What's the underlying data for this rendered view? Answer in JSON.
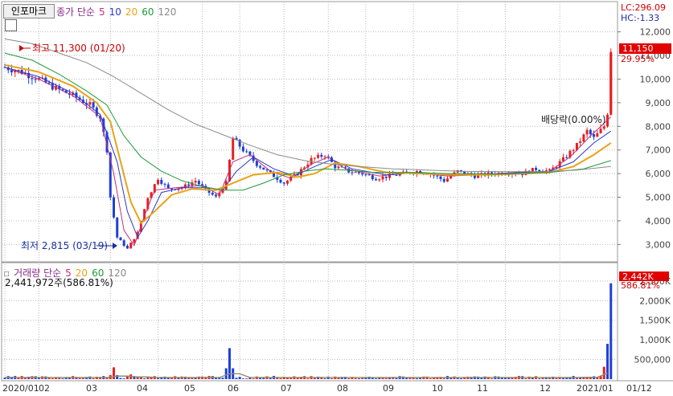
{
  "window": {
    "tab_label": "인포마크",
    "price_legend": {
      "name": "종가 단순",
      "ma": [
        "5",
        "10",
        "20",
        "60",
        "120"
      ]
    },
    "volume_legend": {
      "name": "거래량 단순",
      "ma": [
        "5",
        "20",
        "60",
        "120"
      ]
    }
  },
  "colors": {
    "up": "#e62020",
    "down": "#1f3fd8",
    "ma5": "#c0307a",
    "ma10": "#2c39c8",
    "ma20": "#e8a317",
    "ma60": "#1f9a3a",
    "ma120": "#8a8a8a",
    "label_red": "#cc0000"
  },
  "chart_data": [
    {
      "type": "candlestick",
      "x_ticks": [
        "2020/01",
        "02",
        "03",
        "04",
        "05",
        "06",
        "07",
        "08",
        "09",
        "10",
        "11",
        "12",
        "2021/01",
        "01/12"
      ],
      "y_ticks": [
        "3,000",
        "4,000",
        "5,000",
        "6,000",
        "7,000",
        "8,000",
        "9,000",
        "10,000",
        "11,000",
        "12,000"
      ],
      "ylim": [
        2400,
        12600
      ],
      "annotations": {
        "high": "최고 11,300 (01/20)",
        "low": "최저 2,815 (03/19)",
        "dividend": "배당락(0.00%)",
        "lc": "LC:296.09",
        "hc": "HC:-1.33"
      },
      "last_price": {
        "value": "11,150",
        "change": "29.95%"
      },
      "price_path": [
        [
          0,
          10500
        ],
        [
          5,
          10300
        ],
        [
          10,
          10000
        ],
        [
          15,
          9600
        ],
        [
          20,
          9300
        ],
        [
          25,
          8900
        ],
        [
          28,
          8400
        ],
        [
          30,
          7000
        ],
        [
          31,
          5000
        ],
        [
          33,
          3300
        ],
        [
          36,
          2815
        ],
        [
          39,
          3500
        ],
        [
          42,
          5000
        ],
        [
          45,
          5800
        ],
        [
          48,
          5350
        ],
        [
          52,
          5400
        ],
        [
          56,
          5700
        ],
        [
          59,
          5300
        ],
        [
          62,
          5000
        ],
        [
          65,
          5600
        ],
        [
          67,
          7500
        ],
        [
          70,
          7000
        ],
        [
          74,
          6400
        ],
        [
          78,
          6000
        ],
        [
          82,
          5600
        ],
        [
          86,
          6000
        ],
        [
          90,
          6600
        ],
        [
          94,
          6800
        ],
        [
          97,
          6300
        ],
        [
          101,
          6100
        ],
        [
          105,
          6000
        ],
        [
          109,
          5800
        ],
        [
          113,
          5900
        ],
        [
          117,
          6000
        ],
        [
          121,
          6100
        ],
        [
          125,
          6000
        ],
        [
          129,
          5700
        ],
        [
          133,
          6100
        ],
        [
          138,
          5900
        ],
        [
          143,
          6000
        ],
        [
          148,
          6050
        ],
        [
          152,
          6000
        ],
        [
          156,
          6200
        ],
        [
          160,
          6100
        ],
        [
          164,
          6600
        ],
        [
          168,
          7200
        ],
        [
          171,
          7800
        ],
        [
          173,
          7500
        ],
        [
          176,
          8000
        ],
        [
          177,
          8580
        ],
        [
          178,
          11150
        ]
      ],
      "ma_paths": {
        "ma5": [
          [
            0,
            10500
          ],
          [
            10,
            10000
          ],
          [
            20,
            9300
          ],
          [
            28,
            8400
          ],
          [
            32,
            6000
          ],
          [
            35,
            3600
          ],
          [
            38,
            2950
          ],
          [
            41,
            4200
          ],
          [
            44,
            5300
          ],
          [
            50,
            5400
          ],
          [
            58,
            5500
          ],
          [
            63,
            5100
          ],
          [
            67,
            6500
          ],
          [
            72,
            6800
          ],
          [
            78,
            6100
          ],
          [
            84,
            5800
          ],
          [
            90,
            6400
          ],
          [
            95,
            6700
          ],
          [
            100,
            6200
          ],
          [
            110,
            5900
          ],
          [
            120,
            6050
          ],
          [
            130,
            5900
          ],
          [
            140,
            5950
          ],
          [
            150,
            6050
          ],
          [
            160,
            6100
          ],
          [
            166,
            6700
          ],
          [
            172,
            7600
          ],
          [
            178,
            8400
          ]
        ],
        "ma10": [
          [
            0,
            10500
          ],
          [
            10,
            10100
          ],
          [
            20,
            9400
          ],
          [
            28,
            8500
          ],
          [
            33,
            6500
          ],
          [
            36,
            4400
          ],
          [
            39,
            3300
          ],
          [
            42,
            4000
          ],
          [
            46,
            5200
          ],
          [
            52,
            5400
          ],
          [
            60,
            5400
          ],
          [
            64,
            5300
          ],
          [
            68,
            6100
          ],
          [
            73,
            6700
          ],
          [
            79,
            6200
          ],
          [
            85,
            5900
          ],
          [
            91,
            6300
          ],
          [
            96,
            6600
          ],
          [
            102,
            6200
          ],
          [
            112,
            5950
          ],
          [
            122,
            6050
          ],
          [
            132,
            5950
          ],
          [
            142,
            5950
          ],
          [
            152,
            6050
          ],
          [
            160,
            6100
          ],
          [
            167,
            6500
          ],
          [
            173,
            7300
          ],
          [
            178,
            7800
          ]
        ],
        "ma20": [
          [
            0,
            10600
          ],
          [
            10,
            10300
          ],
          [
            20,
            9700
          ],
          [
            27,
            9000
          ],
          [
            31,
            8200
          ],
          [
            34,
            6500
          ],
          [
            37,
            4800
          ],
          [
            40,
            3900
          ],
          [
            44,
            4400
          ],
          [
            49,
            5100
          ],
          [
            55,
            5350
          ],
          [
            62,
            5300
          ],
          [
            67,
            5600
          ],
          [
            73,
            5950
          ],
          [
            80,
            6050
          ],
          [
            86,
            5850
          ],
          [
            91,
            6000
          ],
          [
            97,
            6450
          ],
          [
            104,
            6300
          ],
          [
            112,
            6050
          ],
          [
            122,
            6000
          ],
          [
            132,
            5950
          ],
          [
            142,
            5950
          ],
          [
            152,
            6000
          ],
          [
            160,
            6050
          ],
          [
            167,
            6300
          ],
          [
            173,
            6800
          ],
          [
            178,
            7300
          ]
        ],
        "ma60": [
          [
            0,
            11100
          ],
          [
            8,
            10800
          ],
          [
            16,
            10200
          ],
          [
            24,
            9500
          ],
          [
            30,
            8900
          ],
          [
            35,
            7600
          ],
          [
            40,
            6700
          ],
          [
            46,
            6100
          ],
          [
            52,
            5700
          ],
          [
            58,
            5450
          ],
          [
            64,
            5300
          ],
          [
            70,
            5300
          ],
          [
            76,
            5600
          ],
          [
            82,
            5950
          ],
          [
            88,
            6100
          ],
          [
            94,
            6200
          ],
          [
            100,
            6150
          ],
          [
            108,
            6050
          ],
          [
            118,
            6050
          ],
          [
            130,
            6000
          ],
          [
            145,
            5980
          ],
          [
            160,
            6050
          ],
          [
            170,
            6200
          ],
          [
            178,
            6550
          ]
        ],
        "ma120": [
          [
            0,
            11700
          ],
          [
            8,
            11500
          ],
          [
            16,
            11100
          ],
          [
            24,
            10700
          ],
          [
            32,
            10100
          ],
          [
            40,
            9400
          ],
          [
            48,
            8700
          ],
          [
            56,
            8100
          ],
          [
            64,
            7650
          ],
          [
            72,
            7200
          ],
          [
            80,
            6800
          ],
          [
            88,
            6550
          ],
          [
            96,
            6400
          ],
          [
            104,
            6300
          ],
          [
            114,
            6200
          ],
          [
            124,
            6150
          ],
          [
            134,
            6100
          ],
          [
            146,
            6080
          ],
          [
            158,
            6080
          ],
          [
            168,
            6150
          ],
          [
            178,
            6300
          ]
        ]
      }
    },
    {
      "type": "bar",
      "title": "거래량",
      "y_ticks": [
        "500,000",
        "1,000K",
        "1,500K",
        "2,000K",
        "2,500K"
      ],
      "ylim": [
        0,
        2600000
      ],
      "summary": "2,441,972주(586.81%)",
      "last_volume": {
        "value": "2,442K",
        "change": "586.81%"
      },
      "spikes": [
        [
          32,
          300000
        ],
        [
          37,
          120000
        ],
        [
          66,
          790000
        ],
        [
          171,
          60000
        ],
        [
          177,
          900000
        ],
        [
          178,
          2441972
        ]
      ],
      "baseline": 55000
    }
  ]
}
